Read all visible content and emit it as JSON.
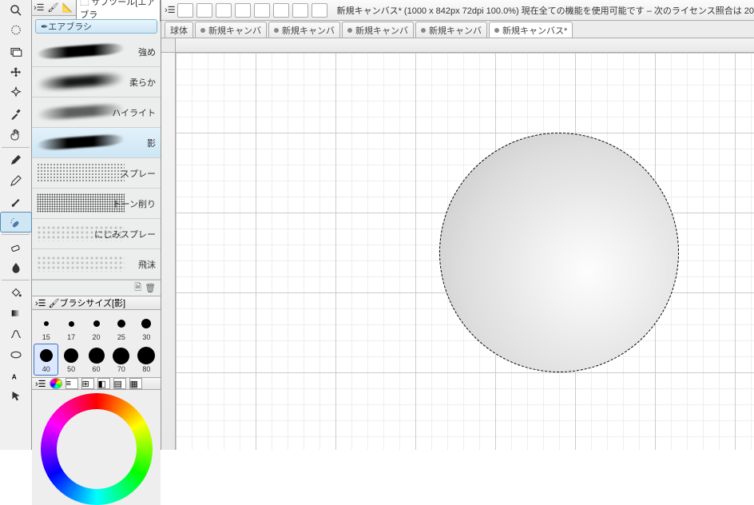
{
  "top": {
    "title": "新規キャンバス* (1000 x 842px 72dpi 100.0%)  現在全ての機能を使用可能です – 次のライセンス照合は 20"
  },
  "tabs": [
    {
      "label": "球体",
      "active": false,
      "dirty": false
    },
    {
      "label": "新規キャンバ",
      "active": false,
      "dirty": true
    },
    {
      "label": "新規キャンバ",
      "active": false,
      "dirty": true
    },
    {
      "label": "新規キャンバ",
      "active": false,
      "dirty": true
    },
    {
      "label": "新規キャンバ",
      "active": false,
      "dirty": true
    },
    {
      "label": "新規キャンバス*",
      "active": true,
      "dirty": true
    }
  ],
  "subtool": {
    "panel_title": "サブツール[エアブラ",
    "group": "エアブラシ",
    "items": [
      {
        "label": "強め",
        "kind": "stroke"
      },
      {
        "label": "柔らか",
        "kind": "soft"
      },
      {
        "label": "ハイライト",
        "kind": "hl"
      },
      {
        "label": "影",
        "kind": "stroke",
        "selected": true
      },
      {
        "label": "スプレー",
        "kind": "spray"
      },
      {
        "label": "トーン削り",
        "kind": "tone"
      },
      {
        "label": "にじみスプレー",
        "kind": "blot"
      },
      {
        "label": "飛沫",
        "kind": "blot"
      }
    ]
  },
  "brushsize": {
    "title": "ブラシサイズ[影]",
    "sizes": [
      {
        "v": 15,
        "d": 6
      },
      {
        "v": 17,
        "d": 7
      },
      {
        "v": 20,
        "d": 8
      },
      {
        "v": 25,
        "d": 10
      },
      {
        "v": 30,
        "d": 12
      },
      {
        "v": 40,
        "d": 16,
        "sel": true
      },
      {
        "v": 50,
        "d": 18
      },
      {
        "v": 60,
        "d": 20
      },
      {
        "v": 70,
        "d": 21
      },
      {
        "v": 80,
        "d": 22
      }
    ]
  },
  "icons": {
    "page": "🗎",
    "trash": "🗑"
  }
}
